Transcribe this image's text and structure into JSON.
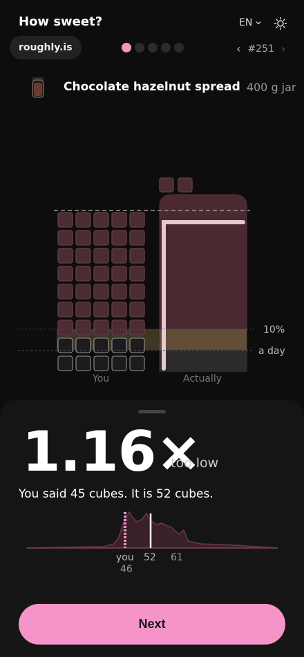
{
  "header": {
    "title": "How sweet?",
    "language": "EN",
    "brand": "roughly.is",
    "puzzle_number": "#251",
    "step_total": 5,
    "step_current": 1,
    "icons": {
      "theme": "sun-icon",
      "lang": "chevron-down-icon",
      "prev": "chevron-left-icon",
      "next": "chevron-right-icon"
    }
  },
  "product": {
    "name": "Chocolate hazelnut spread",
    "quantity": "400 g jar",
    "icon": "jar-icon"
  },
  "chart": {
    "columns": {
      "you": "You",
      "actual": "Actually"
    },
    "markers": {
      "pct": "10%",
      "day": "a day"
    },
    "you_cubes": 45,
    "actual_cubes": 52,
    "colors": {
      "cube": "#4a2d32",
      "cube_top": "#5e3a41",
      "jar": "#4a2a30",
      "highlight": "#f6d9e4",
      "yellow": "#6b5a3a"
    }
  },
  "result": {
    "ratio": "1.16×",
    "verdict": "too low",
    "summary": "You said 45 cubes. It is 52 cubes."
  },
  "distribution": {
    "you_label": "you",
    "you_value": "46",
    "actual_value": "52",
    "peak_value": "61",
    "you_answer": 46,
    "actual_answer": 52
  },
  "actions": {
    "next_label": "Next"
  },
  "colors": {
    "accent": "#f594c8",
    "background": "#0d0d0e",
    "panel": "#151516"
  }
}
